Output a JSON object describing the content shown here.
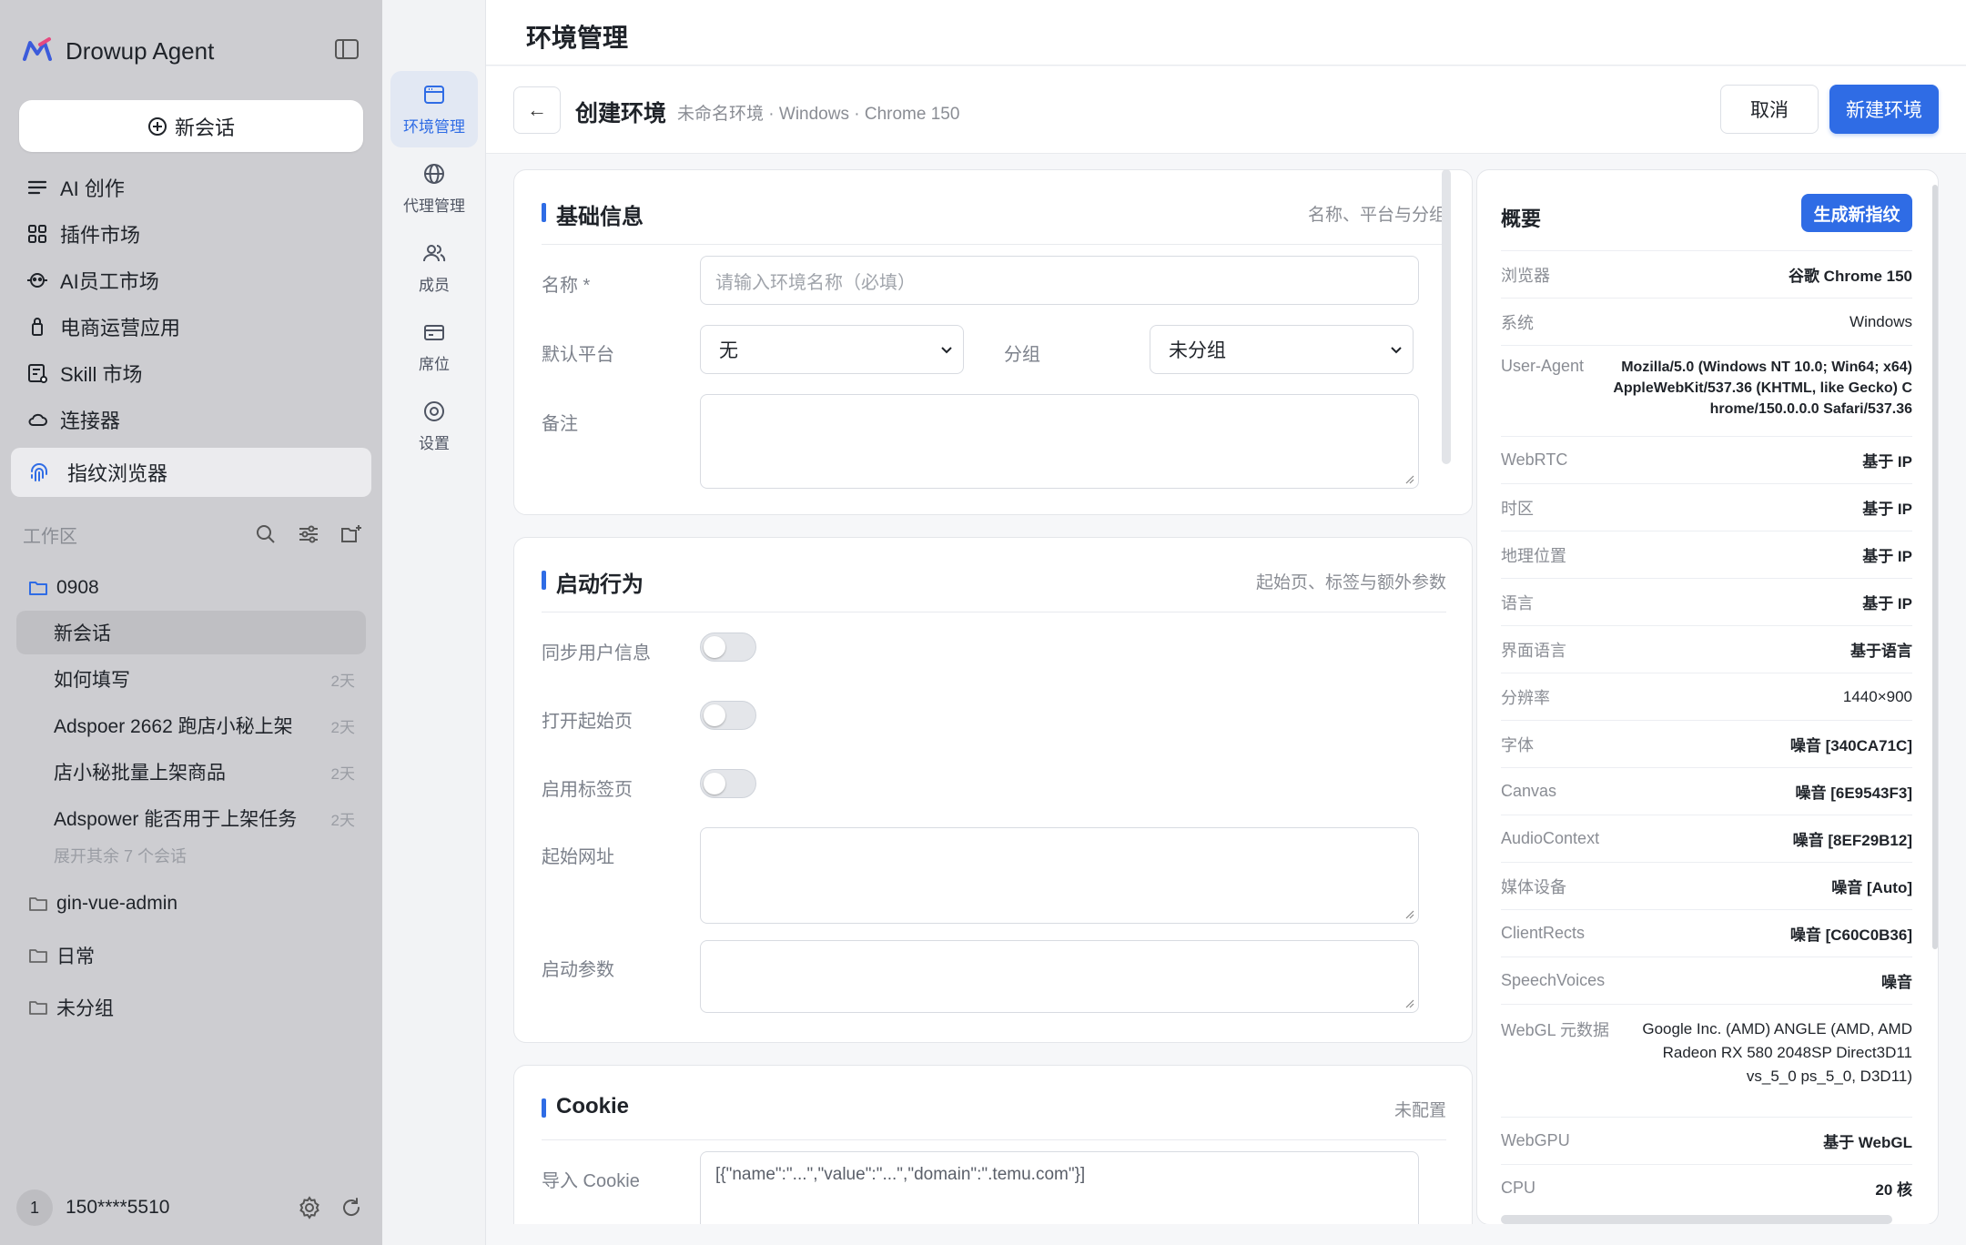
{
  "sidebar": {
    "brand": "Drowup Agent",
    "new_chat": "新会话",
    "nav": [
      {
        "label": "AI 创作",
        "icon": "list-icon"
      },
      {
        "label": "插件市场",
        "icon": "grid-icon"
      },
      {
        "label": "AI员工市场",
        "icon": "robot-icon"
      },
      {
        "label": "电商运营应用",
        "icon": "bag-icon"
      },
      {
        "label": "Skill 市场",
        "icon": "skill-icon"
      },
      {
        "label": "连接器",
        "icon": "cloud-icon"
      },
      {
        "label": "指纹浏览器",
        "icon": "fingerprint-icon"
      }
    ],
    "workspace_label": "工作区",
    "folders": [
      {
        "name": "0908"
      },
      {
        "name": "gin-vue-admin"
      },
      {
        "name": "日常"
      },
      {
        "name": "未分组"
      }
    ],
    "conversations": [
      {
        "title": "新会话",
        "age": ""
      },
      {
        "title": "如何填写",
        "age": "2天"
      },
      {
        "title": "Adspoer 2662 跑店小秘上架",
        "age": "2天"
      },
      {
        "title": "店小秘批量上架商品",
        "age": "2天"
      },
      {
        "title": "Adspower 能否用于上架任务",
        "age": "2天"
      }
    ],
    "expand_more": "展开其余 7 个会话",
    "user": {
      "badge": "1",
      "phone": "150****5510"
    }
  },
  "rail": [
    {
      "label": "环境管理",
      "active": true
    },
    {
      "label": "代理管理"
    },
    {
      "label": "成员"
    },
    {
      "label": "席位"
    },
    {
      "label": "设置"
    }
  ],
  "header": {
    "title": "环境管理"
  },
  "subheader": {
    "back": "←",
    "title": "创建环境",
    "meta": "未命名环境 · Windows · Chrome 150",
    "cancel": "取消",
    "create": "新建环境"
  },
  "basic": {
    "title": "基础信息",
    "desc": "名称、平台与分组",
    "name_label": "名称 *",
    "name_placeholder": "请输入环境名称（必填）",
    "platform_label": "默认平台",
    "platform_value": "无",
    "group_label": "分组",
    "group_value": "未分组",
    "note_label": "备注"
  },
  "launch": {
    "title": "启动行为",
    "desc": "起始页、标签与额外参数",
    "sync_label": "同步用户信息",
    "sync_on": false,
    "start_page_label": "打开起始页",
    "start_page_on": false,
    "tabs_label": "启用标签页",
    "tabs_on": false,
    "url_label": "起始网址",
    "args_label": "启动参数"
  },
  "cookie": {
    "title": "Cookie",
    "desc": "未配置",
    "import_label": "导入 Cookie",
    "import_placeholder": "[{\"name\":\"...\",\"value\":\"...\",\"domain\":\".temu.com\"}]"
  },
  "overview": {
    "title": "概要",
    "generate": "生成新指纹",
    "rows": [
      {
        "k": "浏览器",
        "v": "谷歌 Chrome 150"
      },
      {
        "k": "系统",
        "v": "Windows",
        "norm": true
      },
      {
        "k": "User-Agent",
        "v": "Mozilla/5.0 (Windows NT 10.0; Win64; x64) AppleWebKit/537.36 (KHTML, like Gecko) Chrome/150.0.0.0 Safari/537.36"
      },
      {
        "k": "WebRTC",
        "v": "基于 IP"
      },
      {
        "k": "时区",
        "v": "基于 IP"
      },
      {
        "k": "地理位置",
        "v": "基于 IP"
      },
      {
        "k": "语言",
        "v": "基于 IP"
      },
      {
        "k": "界面语言",
        "v": "基于语言"
      },
      {
        "k": "分辨率",
        "v": "1440×900",
        "norm": true
      },
      {
        "k": "字体",
        "v": "噪音 [340CA71C]"
      },
      {
        "k": "Canvas",
        "v": "噪音 [6E9543F3]"
      },
      {
        "k": "AudioContext",
        "v": "噪音 [8EF29B12]"
      },
      {
        "k": "媒体设备",
        "v": "噪音 [Auto]"
      },
      {
        "k": "ClientRects",
        "v": "噪音 [C60C0B36]"
      },
      {
        "k": "SpeechVoices",
        "v": "噪音"
      },
      {
        "k": "WebGL 元数据",
        "v": "Google Inc. (AMD) ANGLE (AMD, AMD Radeon RX 580 2048SP Direct3D11 vs_5_0 ps_5_0, D3D11)",
        "norm": true
      },
      {
        "k": "WebGPU",
        "v": "基于 WebGL"
      },
      {
        "k": "CPU",
        "v": "20 核"
      }
    ]
  },
  "colors": {
    "accent": "#2f6ce5",
    "sidebar_bg": "#cdcdd1",
    "rail_bg": "#f2f3f5"
  }
}
